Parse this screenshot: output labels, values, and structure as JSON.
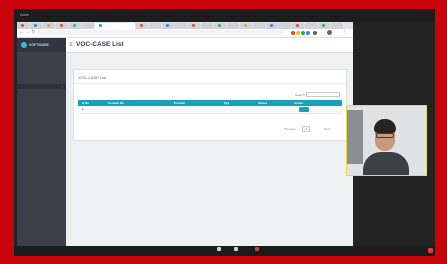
{
  "os": {
    "app_label": "Zoom"
  },
  "browser": {
    "url": "",
    "extension_icons": [
      "google-red-icon",
      "google-yellow-icon",
      "google-green-icon",
      "google-blue-icon",
      "extension-puzzle-icon"
    ],
    "accent_colors": {
      "red": "#ea4335",
      "yellow": "#fbbc05",
      "green": "#34a853",
      "blue": "#4285f4"
    }
  },
  "app": {
    "logo_text": "SOFTWARE",
    "page_heading": "VOC-CASE List",
    "sidebar": {
      "items": [
        {
          "label": ""
        },
        {
          "label": ""
        },
        {
          "label": "",
          "active": true
        }
      ]
    }
  },
  "card": {
    "title": "VOC-CASE List",
    "show_entries": "",
    "search_label": "Search:",
    "search_value": "",
    "table": {
      "headers": [
        "S.No",
        "Contact No",
        "Product",
        "Qty",
        "Status",
        "Action"
      ],
      "rows": [
        {
          "cells": [
            "1",
            "",
            "",
            "",
            "",
            ""
          ],
          "action": ""
        }
      ]
    },
    "info": "",
    "pagination": {
      "prev": "Previous",
      "page": "1",
      "next": "Next"
    }
  },
  "footer": {
    "text": ""
  },
  "meeting_bar": {
    "left_text": "",
    "buttons": [
      {
        "label": "",
        "icon": "mic-icon"
      },
      {
        "label": "",
        "icon": "video-icon"
      },
      {
        "label": "",
        "icon": "share-screen-icon"
      }
    ]
  },
  "camera": {
    "participant_name": ""
  },
  "colors": {
    "frame_border": "#c8040a",
    "table_header": "#17a2b8",
    "cam_border": "#e6df44"
  }
}
